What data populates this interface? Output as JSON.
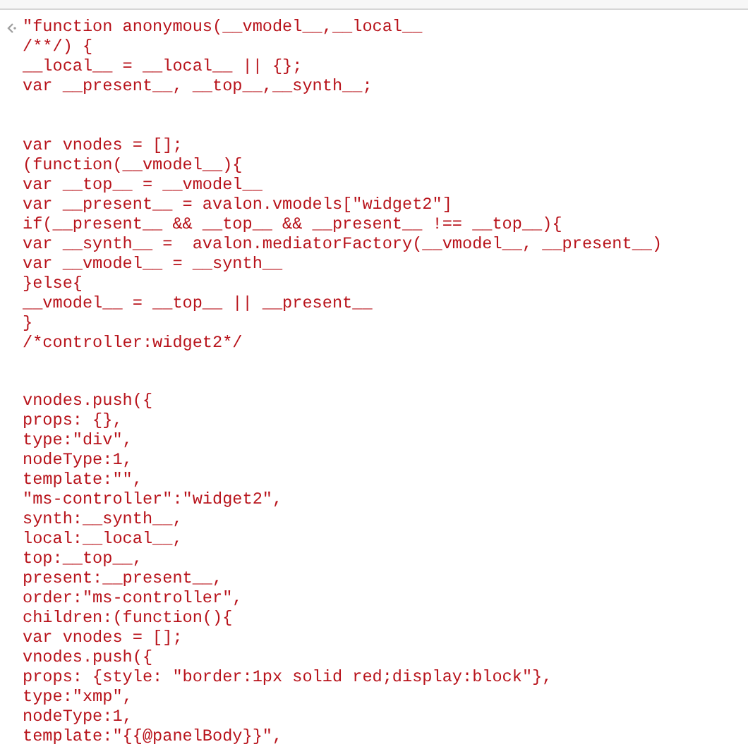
{
  "console": {
    "entries": [
      {
        "kind": "result",
        "blocks": [
          [
            "\"function anonymous(__vmodel__,__local__",
            "/**/) {",
            "__local__ = __local__ || {};",
            "var __present__, __top__,__synth__;"
          ],
          [
            "var vnodes = [];",
            "(function(__vmodel__){",
            "var __top__ = __vmodel__",
            "var __present__ = avalon.vmodels[\"widget2\"]",
            "if(__present__ && __top__ && __present__ !== __top__){",
            "var __synth__ =  avalon.mediatorFactory(__vmodel__, __present__)",
            "var __vmodel__ = __synth__",
            "}else{",
            "__vmodel__ = __top__ || __present__",
            "}",
            "/*controller:widget2*/"
          ],
          [
            "vnodes.push({",
            "props: {},",
            "type:\"div\",",
            "nodeType:1,",
            "template:\"\",",
            "\"ms-controller\":\"widget2\",",
            "synth:__synth__,",
            "local:__local__,",
            "top:__top__,",
            "present:__present__,",
            "order:\"ms-controller\",",
            "children:(function(){",
            "var vnodes = [];",
            "vnodes.push({",
            "props: {style: \"border:1px solid red;display:block\"},",
            "type:\"xmp\",",
            "nodeType:1,",
            "template:\"{{@panelBody}}\","
          ]
        ]
      }
    ]
  }
}
